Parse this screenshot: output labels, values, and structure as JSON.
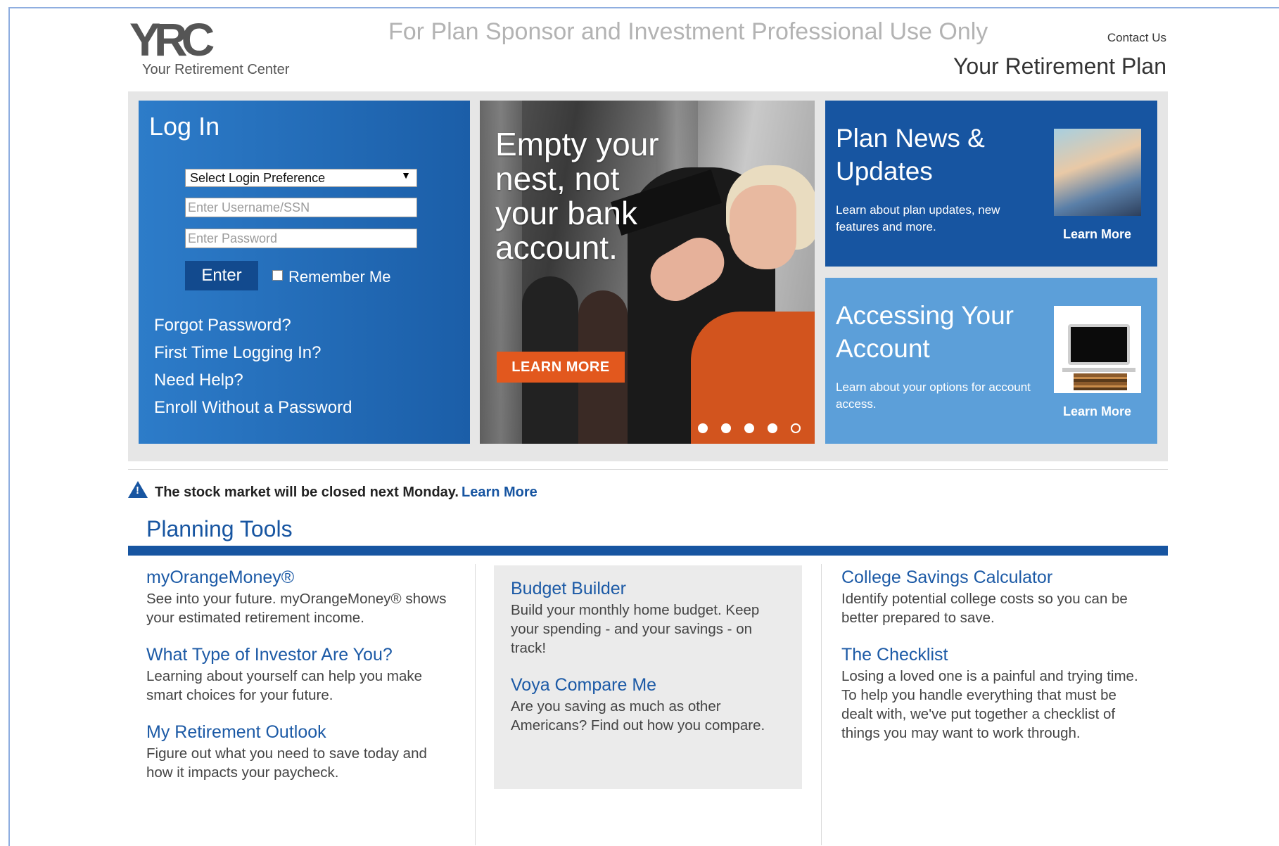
{
  "header": {
    "logo_mark": "YRC",
    "logo_sub": "Your Retirement Center",
    "tagline": "For Plan Sponsor and Investment Professional Use Only",
    "contact": "Contact Us",
    "plan_title": "Your Retirement Plan"
  },
  "login": {
    "title": "Log In",
    "select_value": "Select Login Preference",
    "username_placeholder": "Enter Username/SSN",
    "password_placeholder": "Enter Password",
    "enter_label": "Enter",
    "remember_label": "Remember Me",
    "links": [
      "Forgot Password?",
      "First Time Logging In?",
      "Need Help?",
      "Enroll Without a Password"
    ]
  },
  "banner": {
    "headline": "Empty your nest, not your bank account.",
    "button": "LEARN MORE",
    "slides": 5,
    "active_slide": 5
  },
  "tiles": {
    "news": {
      "title": "Plan News & Updates",
      "text": "Learn about plan updates, new features and more.",
      "learn": "Learn More"
    },
    "access": {
      "title": "Accessing Your Account",
      "text": "Learn about your options for account access.",
      "learn": "Learn More"
    }
  },
  "notice": {
    "text": "The stock market will be closed next Monday.",
    "link": "Learn More"
  },
  "planning": {
    "title": "Planning Tools",
    "col1": [
      {
        "title": "myOrangeMoney®",
        "desc": "See into your future. myOrangeMoney® shows your estimated retirement income."
      },
      {
        "title": "What Type of Investor Are You?",
        "desc": "Learning about yourself can help you make smart choices for your future."
      },
      {
        "title": "My Retirement Outlook",
        "desc": "Figure out what you need to save today and how it impacts your paycheck."
      }
    ],
    "col2": [
      {
        "title": "Budget Builder",
        "desc": "Build your monthly home budget. Keep your spending - and your savings - on track!"
      },
      {
        "title": "Voya Compare Me",
        "desc": "Are you saving as much as other Americans? Find out how you compare."
      }
    ],
    "col3": [
      {
        "title": "College Savings Calculator",
        "desc": "Identify potential college costs so you can be better prepared to save."
      },
      {
        "title": "The Checklist",
        "desc": "Losing a loved one is a painful and trying time. To help you handle everything that must be dealt with, we've put together a checklist of things you may want to work through."
      }
    ]
  }
}
